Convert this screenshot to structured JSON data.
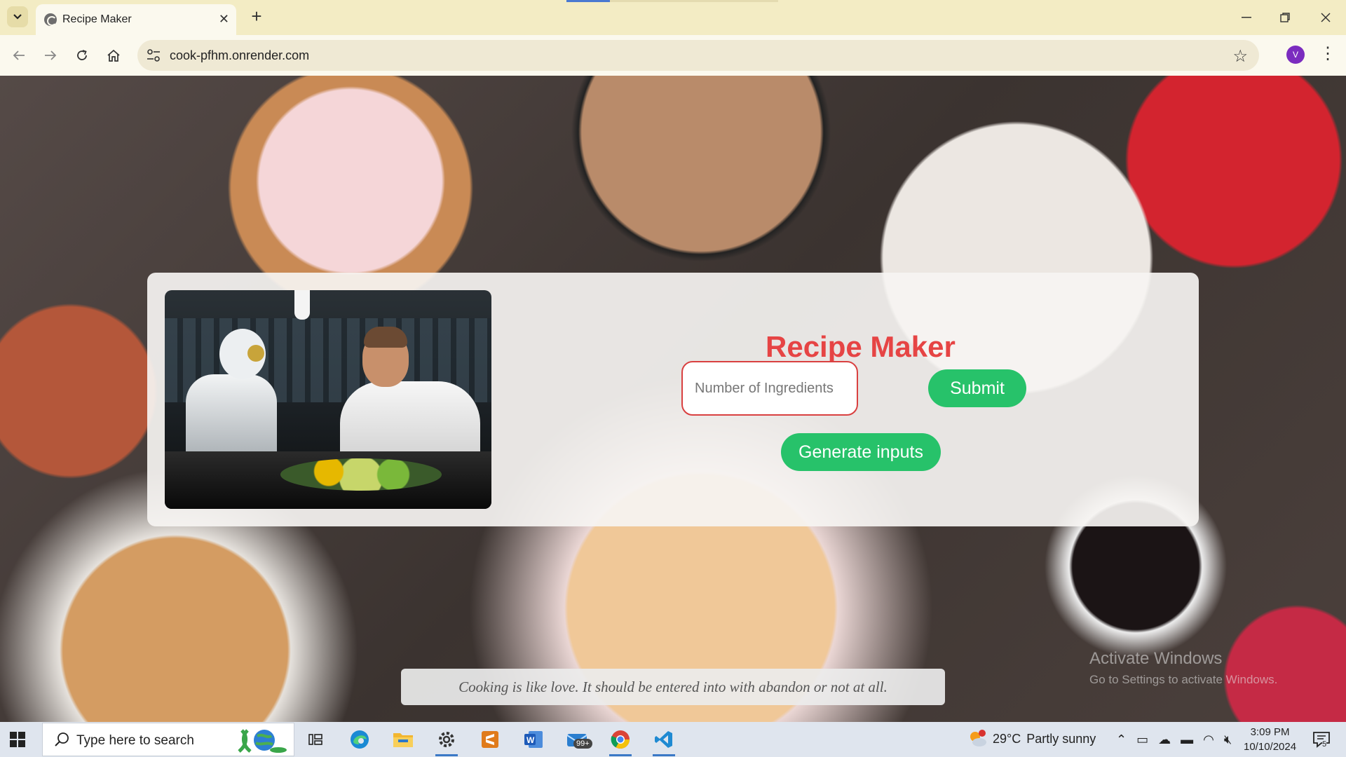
{
  "browser": {
    "tab_title": "Recipe Maker",
    "url": "cook-pfhm.onrender.com",
    "profile_initial": "V"
  },
  "page": {
    "title": "Recipe Maker",
    "ingredients_placeholder": "Number of Ingredients",
    "submit_label": "Submit",
    "generate_label": "Generate inputs",
    "quote": "Cooking is like love. It should be entered into with abandon or not at all.",
    "watermark_line1": "Activate Windows",
    "watermark_line2": "Go to Settings to activate Windows.",
    "colors": {
      "title": "#e64444",
      "button": "#27c26a",
      "input_border": "#d94040"
    }
  },
  "taskbar": {
    "search_placeholder": "Type here to search",
    "mail_badge": "99+",
    "weather_temp": "29°C",
    "weather_desc": "Partly sunny",
    "weather_alert": "1",
    "time": "3:09 PM",
    "date": "10/10/2024",
    "notification_count": "5",
    "apps": [
      "task-view-icon",
      "edge-icon",
      "file-explorer-icon",
      "settings-icon",
      "sublime-text-icon",
      "word-icon",
      "mail-icon",
      "chrome-icon",
      "vscode-icon"
    ]
  }
}
